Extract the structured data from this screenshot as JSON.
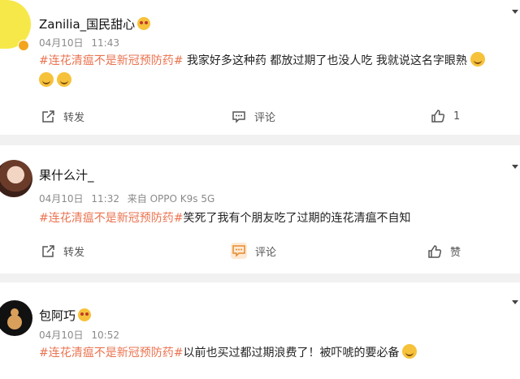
{
  "posts": [
    {
      "username": "Zanilia_国民甜心",
      "date": "04月10日",
      "time": "11:43",
      "source": "",
      "hashtag": "#连花清瘟不是新冠预防药#",
      "text": " 我家好多这种药 都放过期了也没人吃 我就说这名字眼熟",
      "actions": {
        "repost": "转发",
        "comment": "评论",
        "like": "1"
      }
    },
    {
      "username": "果什么汁_",
      "date": "04月10日",
      "time": "11:32",
      "source": "来自 OPPO K9s 5G",
      "hashtag": "#连花清瘟不是新冠预防药#",
      "text": "笑死了我有个朋友吃了过期的连花清瘟不自知",
      "actions": {
        "repost": "转发",
        "comment": "评论",
        "like": "赞"
      }
    },
    {
      "username": "包阿巧",
      "date": "04月10日",
      "time": "10:52",
      "source": "",
      "hashtag": "#连花清瘟不是新冠预防药#",
      "text": "以前也买过都过期浪费了！被吓唬的要必备"
    }
  ],
  "colors": {
    "hashtag": "#eb7350",
    "background": "#f1f1f1",
    "card": "#ffffff"
  }
}
